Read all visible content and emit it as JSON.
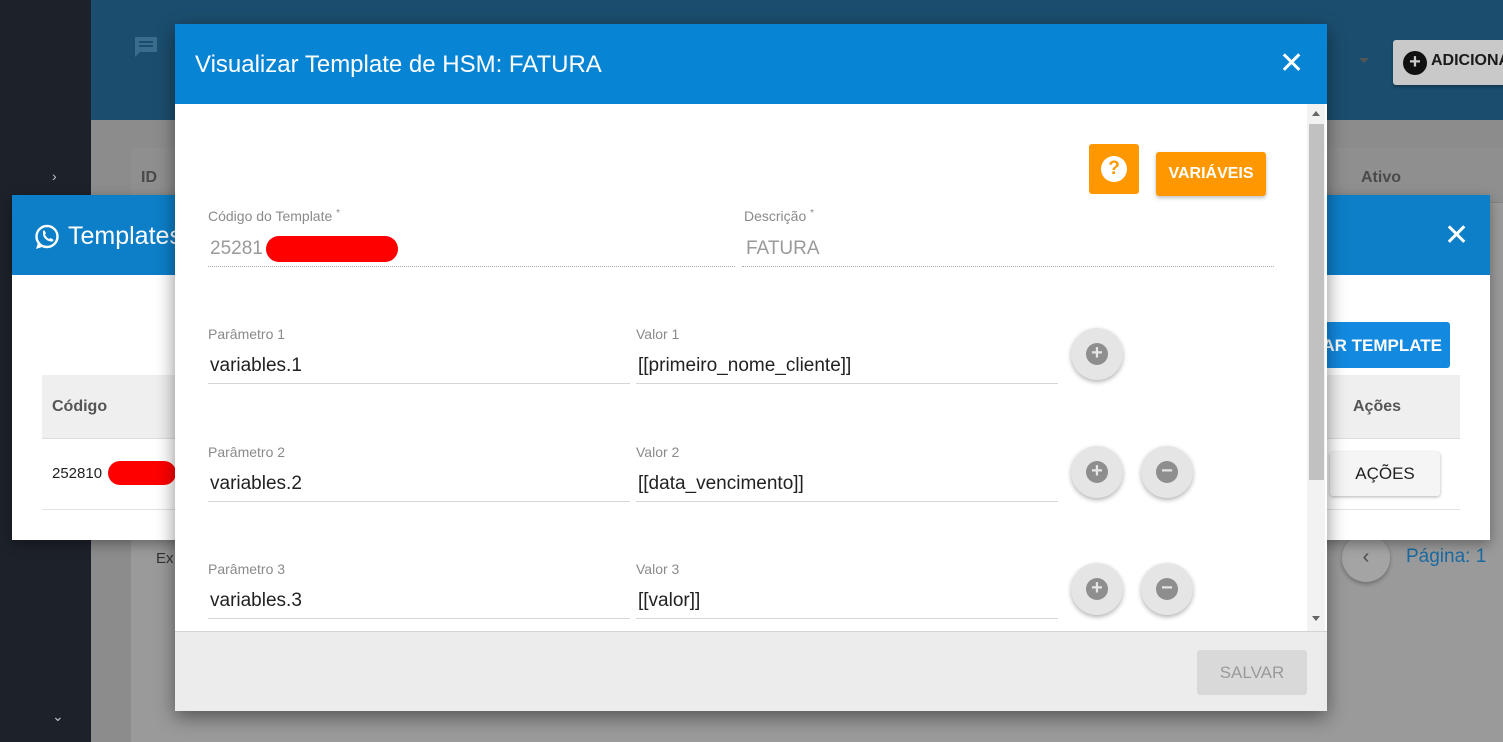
{
  "background_app": {
    "sidebar": {
      "expand_icon": "›",
      "collapse_icon": "⌄"
    },
    "header": {
      "add_button_label": "ADICIONAR"
    },
    "table": {
      "col_id": "ID",
      "col_ativo": "Ativo"
    },
    "footer_text": "Ex",
    "pager": {
      "prev_icon": "‹",
      "page_label": "Página: 1"
    }
  },
  "templates_dialog": {
    "title": "Templates",
    "close_icon": "✕",
    "add_button_label": "AR TEMPLATE",
    "columns": {
      "codigo": "Código",
      "acoes": "Ações"
    },
    "rows": [
      {
        "codigo": "252810",
        "acoes_label": "AÇÕES"
      }
    ]
  },
  "modal": {
    "title": "Visualizar Template de HSM: FATURA",
    "close_icon": "✕",
    "help_icon": "?",
    "variables_button_label": "VARIÁVEIS",
    "codigo_label": "Código do Template",
    "codigo_value": "25281",
    "descricao_label": "Descrição",
    "descricao_value": "FATURA",
    "required_mark": "*",
    "parameters": [
      {
        "param_label": "Parâmetro 1",
        "param_value": "variables.1",
        "valor_label": "Valor 1",
        "valor_value": "[[primeiro_nome_cliente]]"
      },
      {
        "param_label": "Parâmetro 2",
        "param_value": "variables.2",
        "valor_label": "Valor 2",
        "valor_value": "[[data_vencimento]]"
      },
      {
        "param_label": "Parâmetro 3",
        "param_value": "variables.3",
        "valor_label": "Valor 3",
        "valor_value": "[[valor]]"
      }
    ],
    "add_icon": "+",
    "remove_icon": "−",
    "save_button_label": "SALVAR"
  },
  "colors": {
    "primary_blue": "#0784d4",
    "orange": "#ff9800",
    "redaction": "#ff0000"
  }
}
